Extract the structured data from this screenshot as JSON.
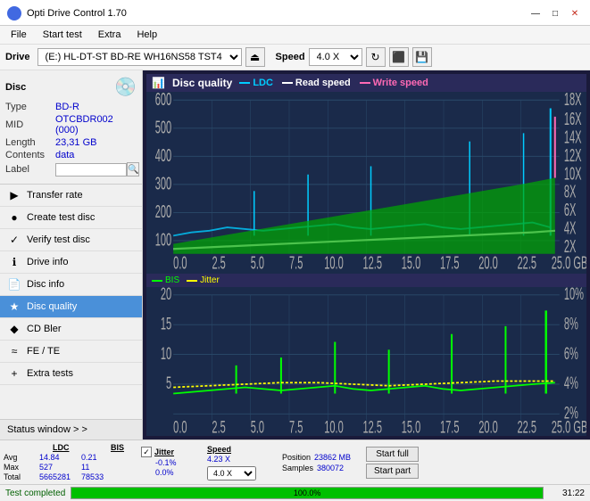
{
  "titlebar": {
    "title": "Opti Drive Control 1.70",
    "logo_color": "#4169e1",
    "min_label": "—",
    "max_label": "□",
    "close_label": "✕"
  },
  "menubar": {
    "items": [
      "File",
      "Start test",
      "Extra",
      "Help"
    ]
  },
  "drivetoolbar": {
    "drive_label": "Drive",
    "drive_value": "(E:)  HL-DT-ST BD-RE  WH16NS58 TST4",
    "speed_label": "Speed",
    "speed_value": "4.0 X"
  },
  "disc": {
    "header": "Disc",
    "type_label": "Type",
    "type_value": "BD-R",
    "mid_label": "MID",
    "mid_value": "OTCBDR002 (000)",
    "length_label": "Length",
    "length_value": "23,31 GB",
    "contents_label": "Contents",
    "contents_value": "data",
    "label_label": "Label",
    "label_value": ""
  },
  "nav": {
    "items": [
      {
        "id": "transfer-rate",
        "label": "Transfer rate",
        "icon": "▶"
      },
      {
        "id": "create-test-disc",
        "label": "Create test disc",
        "icon": "●"
      },
      {
        "id": "verify-test-disc",
        "label": "Verify test disc",
        "icon": "✓"
      },
      {
        "id": "drive-info",
        "label": "Drive info",
        "icon": "ℹ"
      },
      {
        "id": "disc-info",
        "label": "Disc info",
        "icon": "📄"
      },
      {
        "id": "disc-quality",
        "label": "Disc quality",
        "icon": "★",
        "active": true
      },
      {
        "id": "cd-bler",
        "label": "CD Bler",
        "icon": "◆"
      },
      {
        "id": "fe-te",
        "label": "FE / TE",
        "icon": "≈"
      },
      {
        "id": "extra-tests",
        "label": "Extra tests",
        "icon": "+"
      }
    ],
    "status_window": "Status window > >"
  },
  "chart": {
    "title": "Disc quality",
    "legend": [
      {
        "label": "LDC",
        "color": "#00ccff"
      },
      {
        "label": "Read speed",
        "color": "#ffffff"
      },
      {
        "label": "Write speed",
        "color": "#ff69b4"
      }
    ],
    "top": {
      "y_max": 600,
      "y_right_max": 18,
      "x_max": 25,
      "x_ticks": [
        "0.0",
        "2.5",
        "5.0",
        "7.5",
        "10.0",
        "12.5",
        "15.0",
        "17.5",
        "20.0",
        "22.5",
        "25.0"
      ],
      "y_right_labels": [
        "18X",
        "16X",
        "14X",
        "12X",
        "10X",
        "8X",
        "6X",
        "4X",
        "2X"
      ]
    },
    "bottom": {
      "legend": [
        {
          "label": "BIS",
          "color": "#00ff00"
        },
        {
          "label": "Jitter",
          "color": "#ffff00"
        }
      ],
      "y_max": 20,
      "y_right_max": 10,
      "x_max": 25,
      "y_right_labels": [
        "10%",
        "8%",
        "6%",
        "4%",
        "2%"
      ]
    }
  },
  "stats": {
    "headers": [
      "",
      "LDC",
      "BIS",
      "",
      "Jitter",
      "Speed",
      ""
    ],
    "avg_label": "Avg",
    "max_label": "Max",
    "total_label": "Total",
    "ldc_avg": "14.84",
    "ldc_max": "527",
    "ldc_total": "5665281",
    "bis_avg": "0.21",
    "bis_max": "11",
    "bis_total": "78533",
    "jitter_avg": "-0.1%",
    "jitter_max": "0.0%",
    "jitter_total": "",
    "speed_label": "Speed",
    "speed_value": "4.23 X",
    "speed_select": "4.0 X",
    "position_label": "Position",
    "position_value": "23862 MB",
    "samples_label": "Samples",
    "samples_value": "380072",
    "start_full": "Start full",
    "start_part": "Start part"
  },
  "progress": {
    "pct": 100,
    "pct_label": "100.0%",
    "time": "31:22",
    "status": "Test completed"
  }
}
